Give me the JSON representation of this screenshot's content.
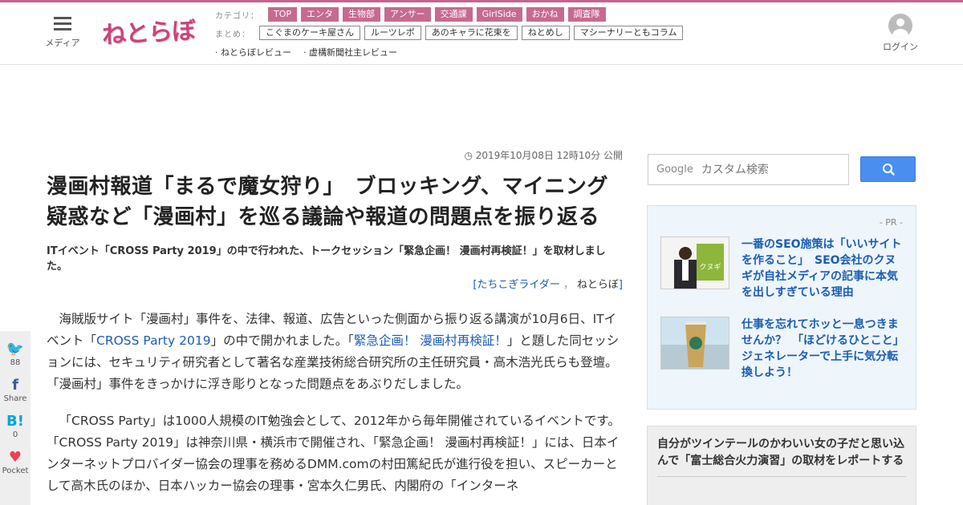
{
  "header": {
    "menu_label": "メディア",
    "logo_text": "ねとらぼ",
    "category_label": "カテゴリ：",
    "categories": [
      "TOP",
      "エンタ",
      "生物部",
      "アンサー",
      "交通課",
      "GirlSide",
      "おかね",
      "調査隊"
    ],
    "summary_label": "まとめ：",
    "summaries": [
      "こぐまのケーキ屋さん",
      "ルーツレポ",
      "あのキャラに花束を",
      "ねとめし",
      "マシーナリーともコラム"
    ],
    "reviews": [
      "· ねとらぼレビュー",
      "· 虚構新聞社主レビュー"
    ],
    "login_label": "ログイン"
  },
  "article": {
    "date": "2019年10月08日 12時10分 公開",
    "title": "漫画村報道「まるで魔女狩り」　ブロッキング、マイニング疑惑など「漫画村」を巡る議論や報道の問題点を振り返る",
    "subtitle": "ITイベント「CROSS Party 2019」の中で行われた、トークセッション「緊急企画！ 漫画村再検証！」を取材しました。",
    "author_open": "[",
    "author_name": "たちこぎライダー",
    "author_sep": "，",
    "author_source": "ねとらぼ",
    "author_close": "]",
    "p1_a": "海賊版サイト「漫画村」事件を、法律、報道、広告といった側面から振り返る講演が10月6日、ITイベント「",
    "p1_link1": "CROSS Party 2019",
    "p1_b": "」の中で開かれました。「",
    "p1_link2": "緊急企画！ 漫画村再検証！",
    "p1_c": "」と題した同セッションには、セキュリティ研究者として著名な産業技術総合研究所の主任研究員・高木浩光氏らも登壇。「漫画村」事件をきっかけに浮き彫りとなった問題点をあぶりだしました。",
    "p2": "「CROSS Party」は1000人規模のIT勉強会として、2012年から毎年開催されているイベントです。「CROSS Party 2019」は神奈川県・横浜市で開催され、「緊急企画！ 漫画村再検証！」には、日本インターネットプロバイダー協会の理事を務めるDMM.comの村田篤紀氏が進行役を担い、スピーカーとして高木氏のほか、日本ハッカー協会の理事・宮本久仁男氏、内閣府の「インターネ"
  },
  "share": [
    {
      "icon": "twitter-icon",
      "glyph": "🐦",
      "count": "88"
    },
    {
      "icon": "facebook-icon",
      "glyph": "f",
      "count": "Share"
    },
    {
      "icon": "hatena-icon",
      "glyph": "B!",
      "count": "0"
    },
    {
      "icon": "pocket-icon",
      "glyph": "♥",
      "count": "Pocket"
    }
  ],
  "sidebar": {
    "search_brand": "Google",
    "search_placeholder": "カスタム検索",
    "pr_label": "- PR -",
    "pr_items": [
      {
        "title": "一番のSEO施策は「いいサイトを作ること」　SEO会社のクヌギが自社メディアの記事に本気を出しすぎている理由",
        "thumb_text": "クヌギ"
      },
      {
        "title": "仕事を忘れてホッと一息つきませんか？　「ほどけるひとこと」ジェネレーターで上手に気分転換しよう！"
      }
    ],
    "bottom_title": "自分がツインテールのかわいい女の子だと思い込んで「富士総合火力演習」の取材をレポートする"
  },
  "colors": {
    "accent": "#c4638e",
    "tag": "#c66a8f",
    "link": "#1a5db4",
    "search_button": "#4a8ef0",
    "twitter": "#1da1f2",
    "facebook": "#3b5998",
    "hatena": "#00a4de",
    "pocket": "#ef4056"
  }
}
